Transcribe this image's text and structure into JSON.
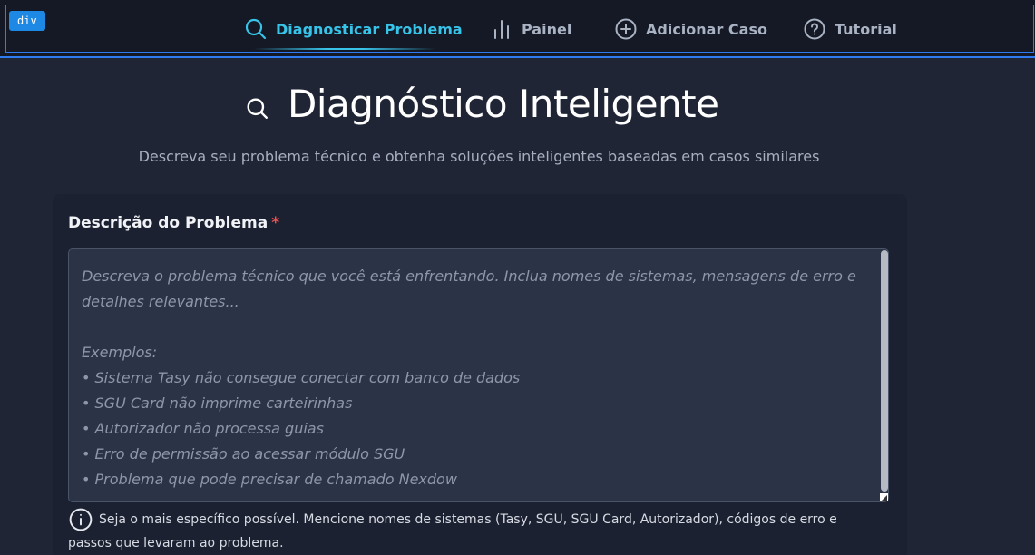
{
  "debug_tag": "div",
  "nav": {
    "items": [
      {
        "label": "Diagnosticar Problema",
        "icon": "search-icon",
        "active": true
      },
      {
        "label": "Painel",
        "icon": "bar-chart-icon",
        "active": false
      },
      {
        "label": "Adicionar Caso",
        "icon": "plus-circle-icon",
        "active": false
      },
      {
        "label": "Tutorial",
        "icon": "help-circle-icon",
        "active": false
      }
    ]
  },
  "hero": {
    "title": "Diagnóstico Inteligente",
    "subtitle": "Descreva seu problema técnico e obtenha soluções inteligentes baseadas em casos similares",
    "icon": "search-icon"
  },
  "form": {
    "label": "Descrição do Problema",
    "required_mark": "*",
    "description": {
      "value": "",
      "placeholder": "Descreva o problema técnico que você está enfrentando. Inclua nomes de sistemas, mensagens de erro e detalhes relevantes...\n\nExemplos:\n• Sistema Tasy não consegue conectar com banco de dados\n• SGU Card não imprime carteirinhas\n• Autorizador não processa guias\n• Erro de permissão ao acessar módulo SGU\n• Problema que pode precisar de chamado Nexdow"
    },
    "hint": "Seja o mais específico possível. Mencione nomes de sistemas (Tasy, SGU, SGU Card, Autorizador), códigos de erro e passos que levaram ao problema.",
    "hint_icon": "info-icon"
  },
  "colors": {
    "accent": "#38c3e8",
    "background": "#1f2535",
    "topbar": "#141925",
    "required": "#ef5350",
    "outline": "#2f7bf2"
  }
}
